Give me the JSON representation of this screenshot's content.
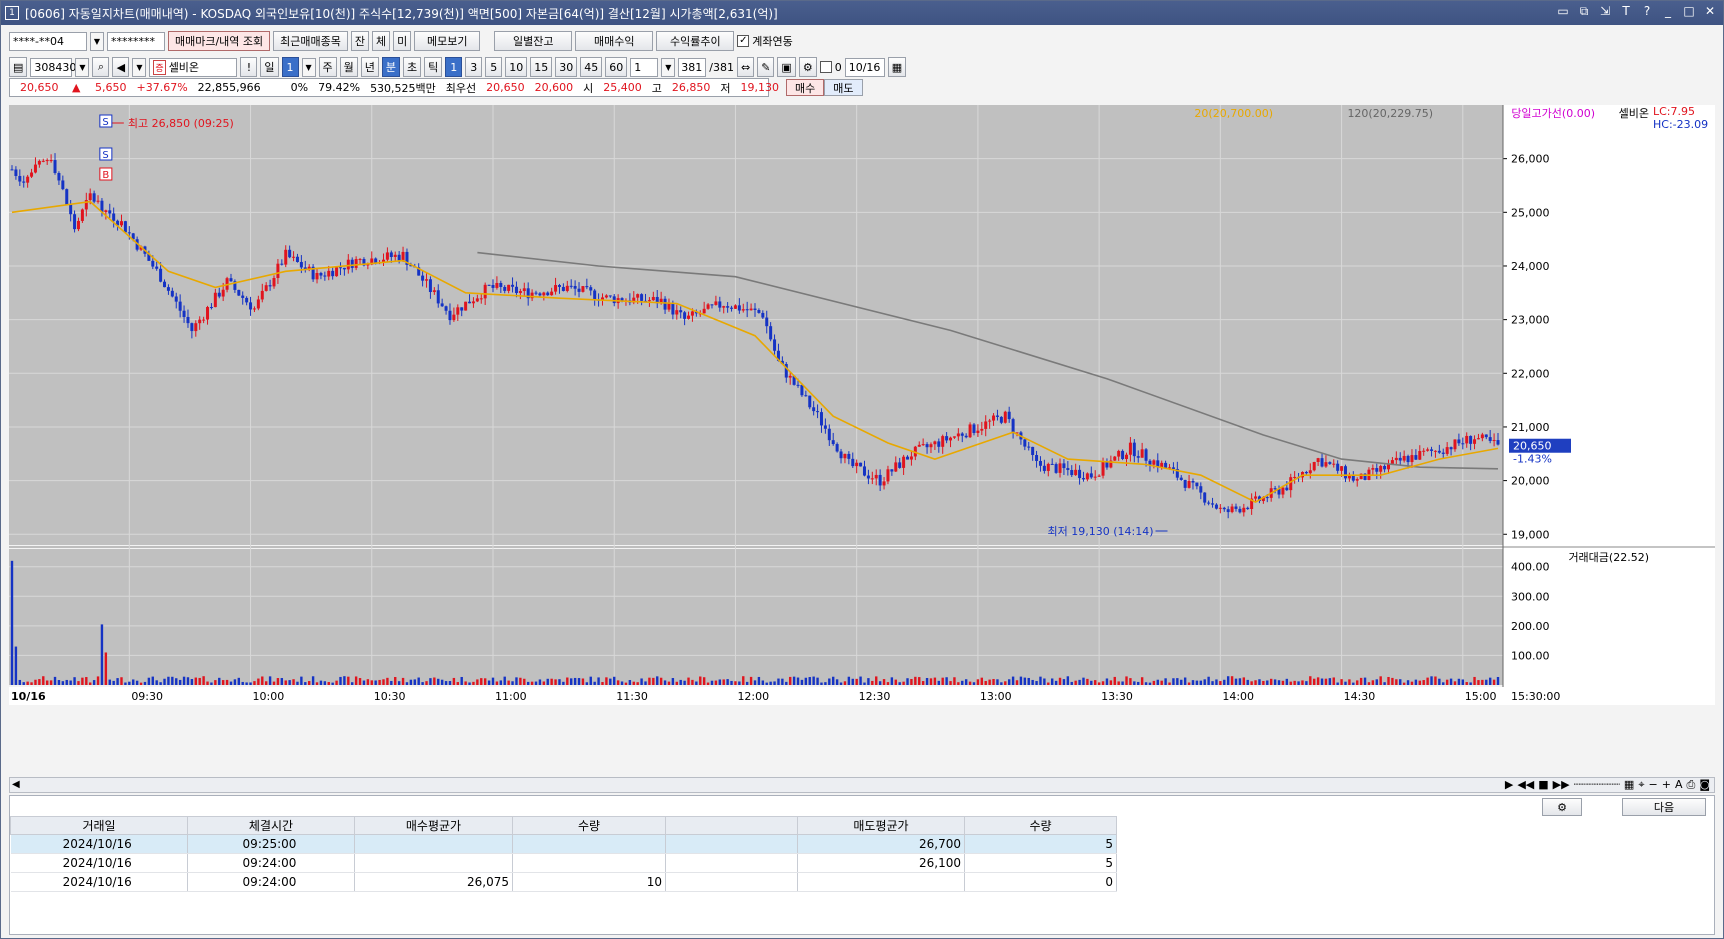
{
  "window": {
    "icon": "1",
    "title": "[0606] 자동일지차트(매매내역) - KOSDAQ 외국인보유[10(천)] 주식수[12,739(천)] 액면[500] 자본금[64(억)] 결산[12월] 시가총액[2,631(억)]",
    "controls": [
      "restore-icon",
      "link-icon",
      "pin-icon",
      "font-icon",
      "help-icon",
      "minimize-icon",
      "maximize-icon",
      "close-icon"
    ]
  },
  "toolbar1": {
    "account": "****-**04",
    "password": "********",
    "tabs": [
      "매매마크/내역 조회",
      "최근매매종목",
      "잔",
      "체",
      "미",
      "메모보기",
      "일별잔고",
      "매매수익",
      "수익률추이"
    ],
    "link_account_label": "계좌연동",
    "link_account_checked": true
  },
  "toolbar2": {
    "code": "308430",
    "stock_flag": "증",
    "stock_name": "셀비온",
    "period_buttons": [
      "일",
      "1",
      "주",
      "월",
      "년",
      "분",
      "초",
      "틱"
    ],
    "minute_buttons": [
      "1",
      "3",
      "5",
      "10",
      "15",
      "30",
      "45",
      "60"
    ],
    "count_value": "1",
    "range": "381",
    "range_total": "/381",
    "date_value": "10/16",
    "extra_box": "0"
  },
  "quote": {
    "price": "20,650",
    "direction": "▲",
    "change": "5,650",
    "change_pct": "+37.67%",
    "volume": "22,855,966",
    "ratio_label": "0%",
    "ratio_value": "79.42%",
    "amount": "530,525백만",
    "best_label": "최우선",
    "ask": "20,650",
    "bid": "20,600",
    "open_label": "시",
    "open": "25,400",
    "high_label": "고",
    "high": "26,850",
    "low_label": "저",
    "low": "19,130",
    "buy_button": "매수",
    "sell_button": "매도"
  },
  "chart_data": {
    "type": "candlestick",
    "date_label": "10/16",
    "legend": {
      "ma20": "20(20,700.00)",
      "ma120": "120(20,229.75)",
      "prev_high": "당일고가선(0.00)",
      "stock": "셀비온",
      "lc": "LC:7.95",
      "hc": "HC:-23.09"
    },
    "ylim": [
      18800,
      27000
    ],
    "y_ticks": [
      "26,000",
      "25,000",
      "24,000",
      "23,000",
      "22,000",
      "21,000",
      "20,000",
      "19,000"
    ],
    "y_tick_values": [
      26000,
      25000,
      24000,
      23000,
      22000,
      21000,
      20000,
      19000
    ],
    "x_ticks": [
      "09:30",
      "10:00",
      "10:30",
      "11:00",
      "11:30",
      "12:00",
      "12:30",
      "13:00",
      "13:30",
      "14:00",
      "14:30",
      "15:00"
    ],
    "x_end": "15:30:00",
    "current_price": "20,650",
    "current_pct": "-1.43%",
    "high_annot": "최고 26,850 (09:25)",
    "low_annot": "최저 19,130 (14:14)",
    "marks": [
      "S",
      "S",
      "B"
    ],
    "price_path": [
      [
        0,
        25800
      ],
      [
        3,
        25600
      ],
      [
        10,
        26050
      ],
      [
        16,
        24700
      ],
      [
        20,
        25300
      ],
      [
        28,
        24800
      ],
      [
        38,
        23800
      ],
      [
        46,
        22800
      ],
      [
        55,
        23700
      ],
      [
        62,
        23200
      ],
      [
        70,
        24200
      ],
      [
        78,
        23800
      ],
      [
        88,
        24100
      ],
      [
        100,
        24200
      ],
      [
        112,
        23100
      ],
      [
        122,
        23600
      ],
      [
        132,
        23500
      ],
      [
        142,
        23600
      ],
      [
        152,
        23400
      ],
      [
        166,
        23350
      ],
      [
        172,
        23000
      ],
      [
        182,
        23300
      ],
      [
        192,
        23100
      ],
      [
        196,
        22200
      ],
      [
        206,
        21200
      ],
      [
        214,
        20300
      ],
      [
        222,
        20000
      ],
      [
        230,
        20500
      ],
      [
        240,
        20800
      ],
      [
        254,
        21200
      ],
      [
        262,
        20300
      ],
      [
        276,
        20100
      ],
      [
        286,
        20600
      ],
      [
        296,
        20200
      ],
      [
        310,
        19400
      ],
      [
        318,
        19600
      ],
      [
        326,
        19900
      ],
      [
        334,
        20400
      ],
      [
        344,
        20000
      ],
      [
        356,
        20400
      ],
      [
        366,
        20600
      ],
      [
        374,
        20800
      ],
      [
        380,
        20650
      ]
    ],
    "ma20_path": [
      [
        0,
        25000
      ],
      [
        20,
        25200
      ],
      [
        40,
        23900
      ],
      [
        52,
        23600
      ],
      [
        70,
        23900
      ],
      [
        100,
        24100
      ],
      [
        116,
        23500
      ],
      [
        140,
        23400
      ],
      [
        170,
        23300
      ],
      [
        190,
        22700
      ],
      [
        210,
        21200
      ],
      [
        224,
        20700
      ],
      [
        236,
        20400
      ],
      [
        248,
        20700
      ],
      [
        256,
        20900
      ],
      [
        270,
        20400
      ],
      [
        290,
        20300
      ],
      [
        304,
        20100
      ],
      [
        318,
        19600
      ],
      [
        330,
        20100
      ],
      [
        350,
        20100
      ],
      [
        365,
        20400
      ],
      [
        380,
        20600
      ]
    ],
    "ma120_path": [
      [
        119,
        24250
      ],
      [
        150,
        24000
      ],
      [
        185,
        23800
      ],
      [
        240,
        22800
      ],
      [
        280,
        21900
      ],
      [
        320,
        20850
      ],
      [
        340,
        20400
      ],
      [
        360,
        20250
      ],
      [
        380,
        20220
      ]
    ],
    "volume_label": "거래대금(22.52)",
    "volume_ticks": [
      "400.00",
      "300.00",
      "200.00",
      "100.00"
    ],
    "volume_tick_values": [
      400,
      300,
      200,
      100
    ],
    "volume_ylim": [
      0,
      460
    ],
    "volume_spikes": [
      [
        0,
        420
      ],
      [
        1,
        130
      ],
      [
        23,
        205
      ],
      [
        24,
        110
      ]
    ]
  },
  "trade_table": {
    "headers": [
      "거래일",
      "체결시간",
      "매수평균가",
      "수량",
      "",
      "매도평균가",
      "수량"
    ],
    "rows": [
      [
        "2024/10/16",
        "09:25:00",
        "",
        "",
        "",
        "26,700",
        "5"
      ],
      [
        "2024/10/16",
        "09:24:00",
        "",
        "",
        "",
        "26,100",
        "5"
      ],
      [
        "2024/10/16",
        "09:24:00",
        "26,075",
        "10",
        "",
        "",
        "0"
      ]
    ],
    "next_button": "다음"
  },
  "colors": {
    "up": "#e0141e",
    "down": "#1533c4",
    "ma20": "#e8a800",
    "ma120": "#7a7a7a",
    "chart_bg": "#c0c0c0"
  }
}
